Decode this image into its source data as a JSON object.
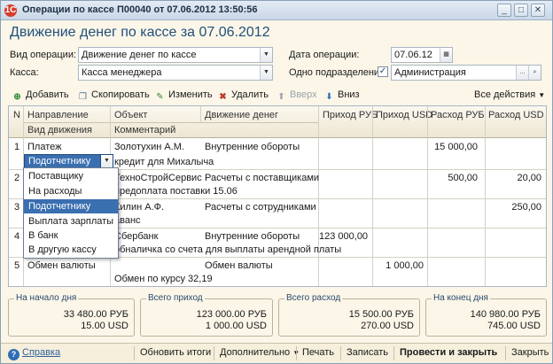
{
  "window": {
    "title": "Операции по кассе П00040 от 07.06.2012 13:50:56",
    "app_icon": "1C"
  },
  "heading": "Движение денег по кассе за 07.06.2012",
  "form": {
    "op_type_label": "Вид операции:",
    "op_type_value": "Движение денег по кассе",
    "op_date_label": "Дата операции:",
    "op_date_value": "07.06.12",
    "cash_label": "Касса:",
    "cash_value": "Касса менеджера",
    "one_unit_label": "Одно подразделение:",
    "one_unit_checked": "✓",
    "one_unit_value": "Администрация",
    "ellipsis": "...",
    "magnifier": "🔍"
  },
  "toolbar": {
    "add": "Добавить",
    "copy": "Скопировать",
    "edit": "Изменить",
    "delete": "Удалить",
    "up": "Вверх",
    "down": "Вниз",
    "all_actions": "Все действия"
  },
  "table": {
    "headers": {
      "n": "N",
      "direction": "Направление",
      "movement_type": "Вид движения",
      "object": "Объект",
      "comment": "Комментарий",
      "money_flow": "Движение денег",
      "in_rub": "Приход РУБ",
      "in_usd": "Приход USD",
      "out_rub": "Расход РУБ",
      "out_usd": "Расход USD"
    },
    "rows": [
      {
        "n": "1",
        "direction": "Платеж",
        "object": "Золотухин А.М.",
        "flow": "Внутренние обороты",
        "in_rub": "",
        "in_usd": "",
        "out_rub": "15 000,00",
        "out_usd": "",
        "type": "Подотчетнику",
        "comment": "кредит для Михалыча"
      },
      {
        "n": "2",
        "direction": "",
        "object": "ТехноСтройСервис",
        "flow": "Расчеты с поставщиками",
        "in_rub": "",
        "in_usd": "",
        "out_rub": "500,00",
        "out_usd": "20,00",
        "type": "",
        "comment": "предоплата поставки 15.06"
      },
      {
        "n": "3",
        "direction": "",
        "object": "Килин А.Ф.",
        "flow": "Расчеты с сотрудниками",
        "in_rub": "",
        "in_usd": "",
        "out_rub": "",
        "out_usd": "250,00",
        "type": "",
        "comment": "аванс"
      },
      {
        "n": "4",
        "direction": "",
        "object": "Сбербанк",
        "flow": "Внутренние обороты",
        "in_rub": "123 000,00",
        "in_usd": "",
        "out_rub": "",
        "out_usd": "",
        "type": "",
        "comment": "обналичка со счета для выплаты арендной платы"
      },
      {
        "n": "5",
        "direction": "Обмен валюты",
        "object": "",
        "flow": "Обмен валюты",
        "in_rub": "",
        "in_usd": "1 000,00",
        "out_rub": "",
        "out_usd": "",
        "type": "",
        "comment": "Обмен по курсу 32,19"
      }
    ]
  },
  "dropdown": {
    "current": "Подотчетнику",
    "options": [
      "Поставщику",
      "На расходы",
      "Подотчетнику",
      "Выплата зарплаты",
      "В банк",
      "В другую кассу"
    ],
    "selected_index": 2
  },
  "totals": [
    {
      "label": "На начало дня",
      "rub": "33 480.00 РУБ",
      "usd": "15.00 USD"
    },
    {
      "label": "Всего приход",
      "rub": "123 000.00 РУБ",
      "usd": "1 000.00 USD"
    },
    {
      "label": "Всего расход",
      "rub": "15 500.00 РУБ",
      "usd": "270.00 USD"
    },
    {
      "label": "На конец дня",
      "rub": "140 980.00 РУБ",
      "usd": "745.00 USD"
    }
  ],
  "footer": {
    "help": "Справка",
    "refresh": "Обновить итоги",
    "more": "Дополнительно",
    "print": "Печать",
    "save": "Записать",
    "post_close": "Провести и закрыть",
    "close": "Закрыть"
  },
  "colors": {
    "accent": "#3a6fb0",
    "heading": "#23507c",
    "background": "#fbf6e8"
  }
}
